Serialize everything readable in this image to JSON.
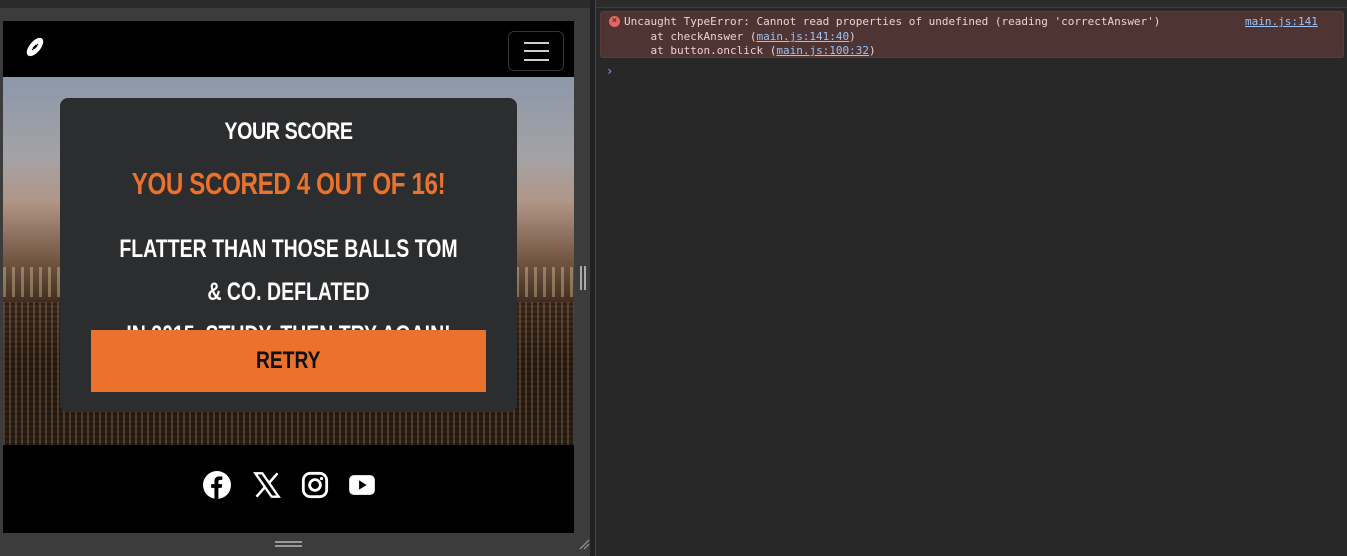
{
  "page": {
    "card": {
      "heading": "YOUR SCORE",
      "score_text": "YOU SCORED 4 OUT OF 16!",
      "message_line1": "FLATTER THAN THOSE BALLS TOM & CO. DEFLATED",
      "message_line2": "IN 2015. STUDY, THEN TRY AGAIN!",
      "retry_label": "RETRY"
    },
    "social": [
      "facebook-icon",
      "x-icon",
      "instagram-icon",
      "youtube-icon"
    ],
    "colors": {
      "accent": "#ea722c",
      "card": "#2c2d2e"
    }
  },
  "console": {
    "error_message": "Uncaught TypeError: Cannot read properties of undefined (reading 'correctAnswer')",
    "error_source": "main.js:141",
    "stack": [
      {
        "prefix": "    at checkAnswer (",
        "link": "main.js:141:40",
        "suffix": ")"
      },
      {
        "prefix": "    at button.onclick (",
        "link": "main.js:100:32",
        "suffix": ")"
      }
    ],
    "prompt_glyph": "›"
  }
}
